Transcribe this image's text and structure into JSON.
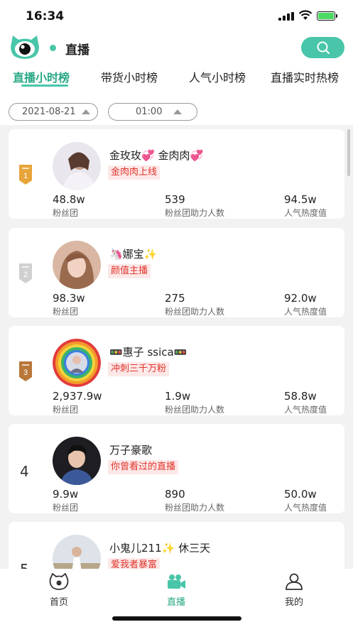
{
  "status_bar": {
    "time": "16:34"
  },
  "header": {
    "title": "直播"
  },
  "tabs": [
    {
      "label": "直播小时榜",
      "active": true
    },
    {
      "label": "带货小时榜",
      "active": false
    },
    {
      "label": "人气小时榜",
      "active": false
    },
    {
      "label": "直播实时热榜",
      "active": false
    }
  ],
  "filters": {
    "date": "2021-08-21",
    "time": "01:00"
  },
  "ranking": [
    {
      "rank": "1",
      "name": "金玫玫💞 金肉肉💞",
      "tag": "金肉肉上线",
      "fans": "48.8w",
      "fans_label": "粉丝团",
      "helpers": "539",
      "helpers_label": "粉丝团助力人数",
      "heat": "94.5w",
      "heat_label": "人气热度值"
    },
    {
      "rank": "2",
      "name": "🦄娜宝✨",
      "tag": "颜值主播",
      "fans": "98.3w",
      "fans_label": "粉丝团",
      "helpers": "275",
      "helpers_label": "粉丝团助力人数",
      "heat": "92.0w",
      "heat_label": "人气热度值"
    },
    {
      "rank": "3",
      "name": "🚥惠子 ssica🚥",
      "tag": "冲刺三千万粉",
      "fans": "2,937.9w",
      "fans_label": "粉丝团",
      "helpers": "1.9w",
      "helpers_label": "粉丝团助力人数",
      "heat": "58.8w",
      "heat_label": "人气热度值"
    },
    {
      "rank": "4",
      "name": "万子豪歌",
      "tag": "你曾看过的直播",
      "fans": "9.9w",
      "fans_label": "粉丝团",
      "helpers": "890",
      "helpers_label": "粉丝团助力人数",
      "heat": "50.0w",
      "heat_label": "人气热度值"
    },
    {
      "rank": "5",
      "name": "小鬼儿211✨ 休三天",
      "tag": "爱我者暴富"
    }
  ],
  "bottom_nav": [
    {
      "label": "首页",
      "icon": "home-icon"
    },
    {
      "label": "直播",
      "icon": "camera-icon",
      "active": true
    },
    {
      "label": "我的",
      "icon": "user-icon"
    }
  ],
  "colors": {
    "accent": "#49c6a9",
    "tag_text": "#e0352b",
    "tag_bg": "#fde8e8",
    "gold": "#e8a43a",
    "silver": "#d0d0d0",
    "bronze": "#b9773a"
  }
}
